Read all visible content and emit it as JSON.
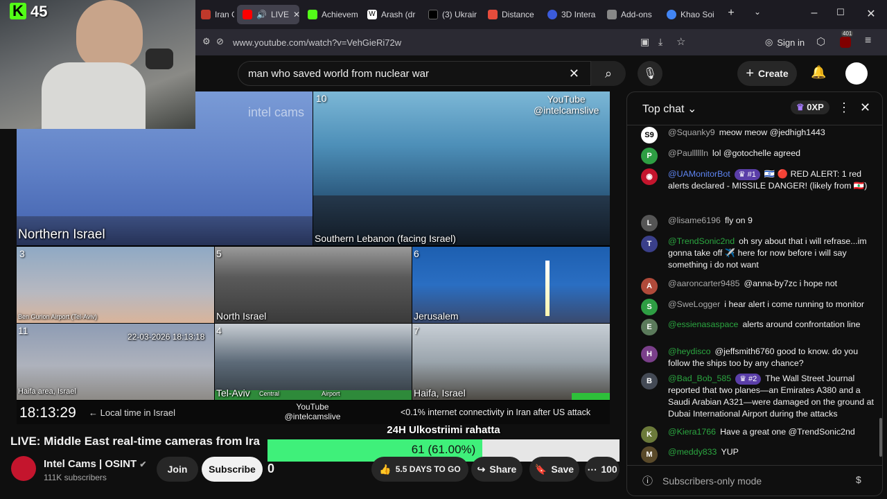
{
  "browser": {
    "tabs": [
      {
        "label": "Iran Guar",
        "color": "#c0392b"
      },
      {
        "label": "LIVE",
        "color": "#ff0000"
      },
      {
        "label": "Achievem",
        "color": "#53fc18"
      },
      {
        "label": "Arash (dr",
        "color": "#ffffff"
      },
      {
        "label": "(3) Ukrair",
        "color": "#000000"
      },
      {
        "label": "Distance",
        "color": "#e74c3c"
      },
      {
        "label": "3D Intera",
        "color": "#3b5bdb"
      },
      {
        "label": "Add-ons",
        "color": "#888888"
      },
      {
        "label": "Khao Soi",
        "color": "#4285f4"
      }
    ],
    "new_tab": "+",
    "url": "www.youtube.com/watch?v=VehGieRi72w",
    "sign_in": "Sign in",
    "ext_badge": "401"
  },
  "stream_overlay": {
    "kick_logo": "K",
    "viewer_count": "45",
    "goal_title": "24H Ulkostriimi rahatta",
    "goal_text": "61 (61.00%)",
    "goal_fraction": 0.61,
    "counter_text": "5.5 DAYS TO GO"
  },
  "youtube": {
    "search_query": "man who saved world from nuclear war",
    "create_label": "Create",
    "video_title": "LIVE: Middle East real-time cameras from Ira",
    "channel_name": "Intel Cams | OSINT",
    "subscribers": "111K subscribers",
    "join_label": "Join",
    "subscribe_label": "Subscribe",
    "like_count": "0",
    "share_label": "Share",
    "save_label": "Save",
    "more_label": "100"
  },
  "video": {
    "watermark": "intel cams",
    "yt_credit_line1": "YouTube",
    "yt_credit_line2": "@intelcamslive",
    "cameras": [
      {
        "num": "",
        "label": "Northern Israel"
      },
      {
        "num": "10",
        "label": "Southern Lebanon (facing Israel)"
      },
      {
        "num": "3",
        "label": "Ben Gurion Airport (Tel-Aviv)"
      },
      {
        "num": "5",
        "label": "North Israel"
      },
      {
        "num": "6",
        "label": "Jerusalem"
      },
      {
        "num": "11",
        "label": "Haifa area, Israel",
        "timestamp": "22-03-2026 18:13:18"
      },
      {
        "num": "4",
        "label": "Tel-Aviv",
        "sub1": "Central",
        "sub2": "Airport"
      },
      {
        "num": "7",
        "label": "Haifa, Israel"
      }
    ],
    "clock": "18:13:29",
    "clock_note": "← Local time in Israel",
    "ticker": "<0.1% internet connectivity in Iran after US attack"
  },
  "chat": {
    "header": "Top chat",
    "points": "0XP",
    "footer": "Subscribers-only mode",
    "messages": [
      {
        "avatar": "S9",
        "avatar_color": "#ffffff",
        "name": "@Squanky9",
        "name_class": "",
        "text": "meow meow @jedhigh1443"
      },
      {
        "avatar": "P",
        "avatar_color": "#2e9e43",
        "name": "@Paulllllln",
        "name_class": "",
        "text": "lol @gotochelle agreed"
      },
      {
        "avatar": "◉",
        "avatar_color": "#c4152d",
        "name": "@UAMonitorBot",
        "name_class": "mod",
        "badge": "#1",
        "text": "🇮🇱 🔴 RED ALERT: 1 red alerts declared - MISSILE DANGER! (likely from 🇱🇧)"
      },
      {
        "avatar": "L",
        "avatar_color": "#555555",
        "name": "@lisame6196",
        "name_class": "",
        "text": "fly on 9"
      },
      {
        "avatar": "T",
        "avatar_color": "#3a3f8a",
        "name": "@TrendSonic2nd",
        "name_class": "mem",
        "text": "oh sry about that i will refrase...im gonna take off ✈️ here for now before i will say something i do not want"
      },
      {
        "avatar": "A",
        "avatar_color": "#b04a3a",
        "name": "@aaroncarter9485",
        "name_class": "",
        "text": "@anna-by7zc i hope not"
      },
      {
        "avatar": "S",
        "avatar_color": "#2e9e43",
        "name": "@SweLogger",
        "name_class": "",
        "text": "i hear alert i come running to monitor"
      },
      {
        "avatar": "E",
        "avatar_color": "#5b7a5b",
        "name": "@essienasaspace",
        "name_class": "mem",
        "text": "alerts around confrontation line"
      },
      {
        "avatar": "H",
        "avatar_color": "#7a3f8a",
        "name": "@heydisco",
        "name_class": "mem",
        "text": "@jeffsmith6760 good to know. do you follow the ships too by any chance?"
      },
      {
        "avatar": "B",
        "avatar_color": "#444a55",
        "name": "@Bad_Bob_585",
        "name_class": "mem",
        "badge": "#2",
        "text": "The Wall Street Journal reported that two planes—an Emirates A380 and a Saudi Arabian A321—were damaged on the ground at Dubai International Airport during the attacks"
      },
      {
        "avatar": "K",
        "avatar_color": "#6b7a3a",
        "name": "@Kiera1766",
        "name_class": "mem",
        "text": "Have a great one @TrendSonic2nd"
      },
      {
        "avatar": "M",
        "avatar_color": "#5a4a2a",
        "name": "@meddy833",
        "name_class": "mem",
        "text": "YUP"
      }
    ]
  }
}
